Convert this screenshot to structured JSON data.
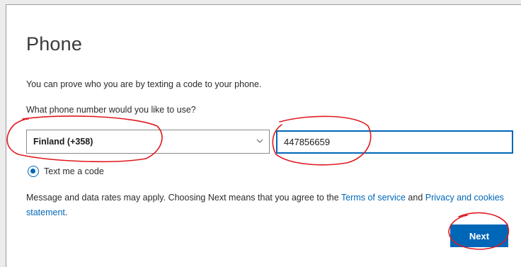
{
  "form": {
    "title": "Phone",
    "description": "You can prove who you are by texting a code to your phone.",
    "question": "What phone number would you like to use?",
    "country_select": {
      "selected": "Finland (+358)"
    },
    "phone_input": {
      "value": "447856659"
    },
    "method_option": {
      "label": "Text me a code",
      "selected": true
    },
    "disclaimer_prefix": "Message and data rates may apply. Choosing Next means that you agree to the ",
    "terms_link": "Terms of service",
    "disclaimer_and": " and ",
    "privacy_link": "Privacy and cookies statement",
    "disclaimer_suffix": ".",
    "next_button": "Next"
  },
  "colors": {
    "accent": "#0067b8",
    "annotation": "#e0191f",
    "background": "#ffffff"
  },
  "icons": {
    "select_chevron": "chevron-down-icon",
    "radio": "radio-selected-icon"
  }
}
